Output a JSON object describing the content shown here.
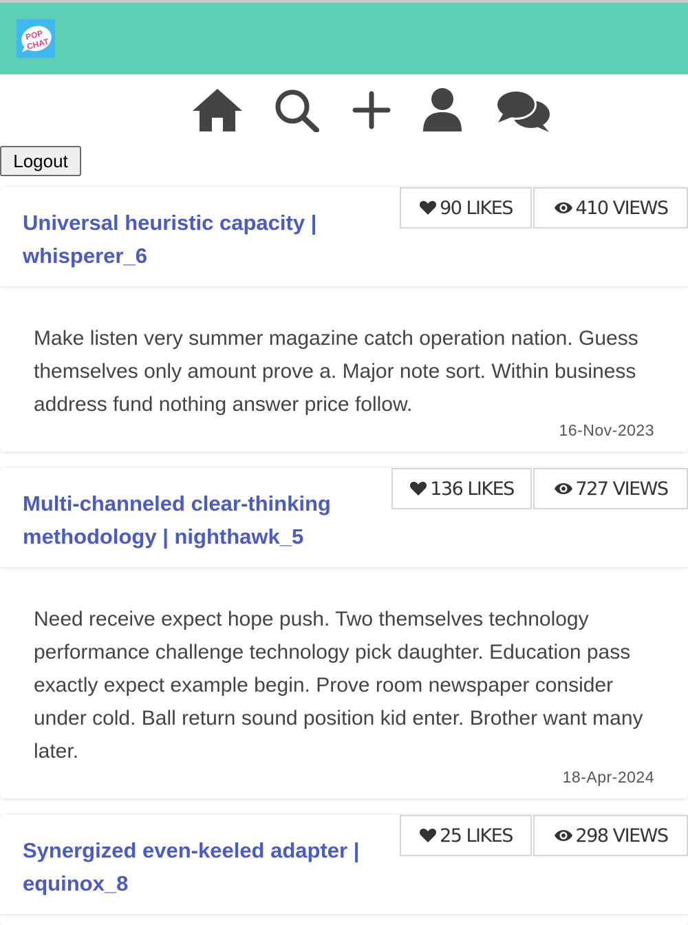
{
  "app": {
    "logo_text_top": "POP",
    "logo_text_bottom": "CHAT"
  },
  "colors": {
    "header_bg": "#5dcfb4",
    "title_link": "#4a5bc4",
    "icon": "#444444"
  },
  "nav": [
    {
      "name": "home",
      "icon": "home-icon"
    },
    {
      "name": "search",
      "icon": "search-icon"
    },
    {
      "name": "create",
      "icon": "plus-icon"
    },
    {
      "name": "profile",
      "icon": "user-icon"
    },
    {
      "name": "messages",
      "icon": "comments-icon"
    }
  ],
  "logout_label": "Logout",
  "posts": [
    {
      "title": "Universal heuristic capacity | whisperer_6",
      "likes": "90 LIKES",
      "views": "410 VIEWS",
      "body": "Make listen very summer magazine catch operation nation. Guess themselves only amount prove a. Major note sort. Within business address fund nothing answer price follow.",
      "date": "16-Nov-2023"
    },
    {
      "title": "Multi-channeled clear-thinking methodology | nighthawk_5",
      "likes": "136 LIKES",
      "views": "727 VIEWS",
      "body": "Need receive expect hope push. Two themselves technology performance challenge technology pick daughter. Education pass exactly expect example begin. Prove room newspaper consider under cold. Ball return sound position kid enter. Brother want many later.",
      "date": "18-Apr-2024"
    },
    {
      "title": "Synergized even-keeled adapter | equinox_8",
      "likes": "25 LIKES",
      "views": "298 VIEWS"
    }
  ]
}
